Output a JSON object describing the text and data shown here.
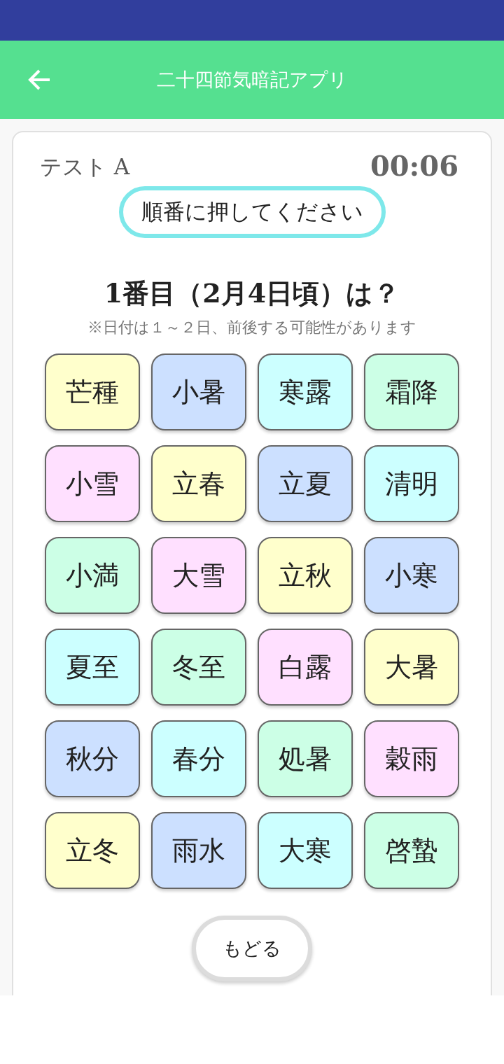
{
  "app_bar": {
    "title": "二十四節気暗記アプリ"
  },
  "test": {
    "name": "テスト A",
    "timer": "00:06",
    "instruction": "順番に押してください",
    "question": "1番目（2月4日頃）は？",
    "note": "※日付は１～２日、前後する可能性があります"
  },
  "tiles": [
    {
      "label": "芒種",
      "color": "#ffffcc"
    },
    {
      "label": "小暑",
      "color": "#cce0ff"
    },
    {
      "label": "寒露",
      "color": "#ccffff"
    },
    {
      "label": "霜降",
      "color": "#ccffe6"
    },
    {
      "label": "小雪",
      "color": "#ffe0ff"
    },
    {
      "label": "立春",
      "color": "#ffffcc"
    },
    {
      "label": "立夏",
      "color": "#cce0ff"
    },
    {
      "label": "清明",
      "color": "#ccffff"
    },
    {
      "label": "小満",
      "color": "#ccffe6"
    },
    {
      "label": "大雪",
      "color": "#ffe0ff"
    },
    {
      "label": "立秋",
      "color": "#ffffcc"
    },
    {
      "label": "小寒",
      "color": "#cce0ff"
    },
    {
      "label": "夏至",
      "color": "#ccffff"
    },
    {
      "label": "冬至",
      "color": "#ccffe6"
    },
    {
      "label": "白露",
      "color": "#ffe0ff"
    },
    {
      "label": "大暑",
      "color": "#ffffcc"
    },
    {
      "label": "秋分",
      "color": "#cce0ff"
    },
    {
      "label": "春分",
      "color": "#ccffff"
    },
    {
      "label": "処暑",
      "color": "#ccffe6"
    },
    {
      "label": "穀雨",
      "color": "#ffe0ff"
    },
    {
      "label": "立冬",
      "color": "#ffffcc"
    },
    {
      "label": "雨水",
      "color": "#cce0ff"
    },
    {
      "label": "大寒",
      "color": "#ccffff"
    },
    {
      "label": "啓蟄",
      "color": "#ccffe6"
    }
  ],
  "back_button": "もどる"
}
